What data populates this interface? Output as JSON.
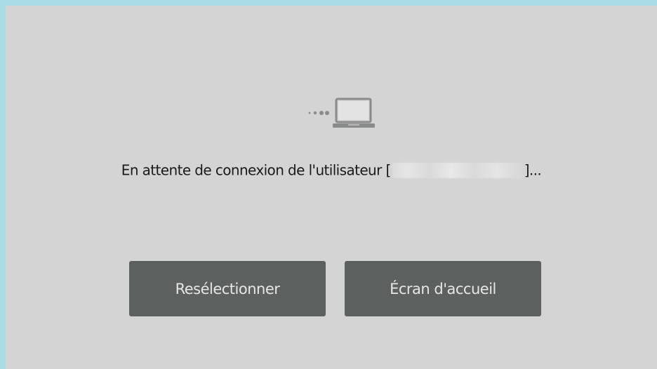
{
  "status": {
    "icon": "laptop-connecting-icon",
    "message_prefix": "En attente de connexion de l'utilisateur [",
    "message_suffix": "]...",
    "username_redacted": true
  },
  "buttons": {
    "reselect_label": "Resélectionner",
    "home_label": "Écran d'accueil"
  },
  "colors": {
    "frame": "#a8dce2",
    "background": "#d3d4d3",
    "button": "#5c605f",
    "button_text": "#e6e6e6",
    "icon": "#8a8c8b"
  }
}
